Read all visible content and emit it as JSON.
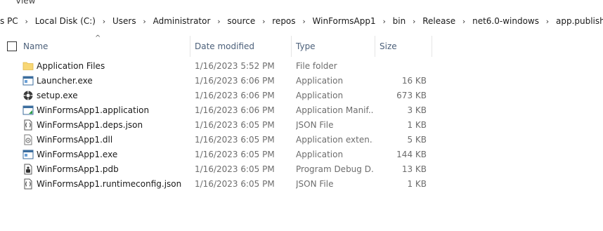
{
  "ribbon": {
    "view_label": "View"
  },
  "breadcrumb": [
    "s PC",
    "Local Disk (C:)",
    "Users",
    "Administrator",
    "source",
    "repos",
    "WinFormsApp1",
    "bin",
    "Release",
    "net6.0-windows",
    "app.publish"
  ],
  "columns": {
    "name": "Name",
    "date": "Date modified",
    "type": "Type",
    "size": "Size"
  },
  "files": [
    {
      "name": "Application Files",
      "date": "1/16/2023 5:52 PM",
      "type": "File folder",
      "size": "",
      "icon": "folder-icon"
    },
    {
      "name": "Launcher.exe",
      "date": "1/16/2023 6:06 PM",
      "type": "Application",
      "size": "16 KB",
      "icon": "application-icon"
    },
    {
      "name": "setup.exe",
      "date": "1/16/2023 6:06 PM",
      "type": "Application",
      "size": "673 KB",
      "icon": "setup-icon"
    },
    {
      "name": "WinFormsApp1.application",
      "date": "1/16/2023 6:06 PM",
      "type": "Application Manif...",
      "size": "3 KB",
      "icon": "manifest-icon"
    },
    {
      "name": "WinFormsApp1.deps.json",
      "date": "1/16/2023 6:05 PM",
      "type": "JSON File",
      "size": "1 KB",
      "icon": "json-icon"
    },
    {
      "name": "WinFormsApp1.dll",
      "date": "1/16/2023 6:05 PM",
      "type": "Application exten...",
      "size": "5 KB",
      "icon": "dll-icon"
    },
    {
      "name": "WinFormsApp1.exe",
      "date": "1/16/2023 6:05 PM",
      "type": "Application",
      "size": "144 KB",
      "icon": "application-icon"
    },
    {
      "name": "WinFormsApp1.pdb",
      "date": "1/16/2023 6:05 PM",
      "type": "Program Debug D...",
      "size": "13 KB",
      "icon": "pdb-icon"
    },
    {
      "name": "WinFormsApp1.runtimeconfig.json",
      "date": "1/16/2023 6:05 PM",
      "type": "JSON File",
      "size": "1 KB",
      "icon": "json-icon"
    }
  ],
  "colors": {
    "header_text": "#4c607a",
    "secondary_text": "#6d6d6d",
    "folder_yellow": "#f8d775"
  }
}
